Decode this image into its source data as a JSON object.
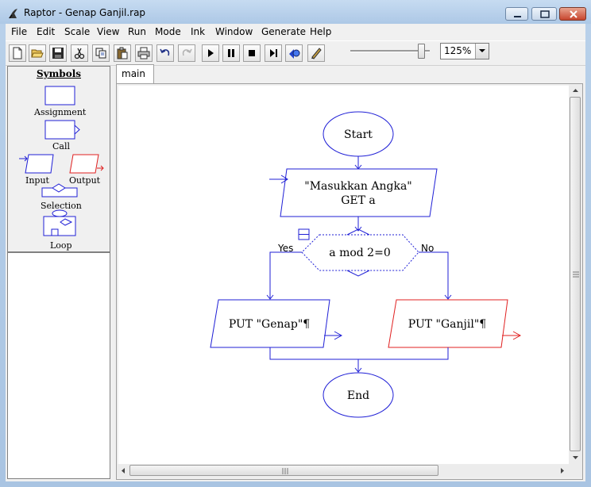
{
  "window": {
    "title": "Raptor - Genap Ganjil.rap"
  },
  "menu": [
    "File",
    "Edit",
    "Scale",
    "View",
    "Run",
    "Mode",
    "Ink",
    "Window",
    "Generate",
    "Help"
  ],
  "toolbar": {
    "buttons": [
      "new-file",
      "open-folder",
      "save",
      "cut",
      "copy",
      "paste",
      "print",
      "undo",
      "redo",
      "run",
      "pause",
      "stop",
      "step",
      "compile",
      "pen"
    ],
    "zoom": "125%",
    "speed_level_percent": 90
  },
  "symbols": {
    "title": "Symbols",
    "assignment": "Assignment",
    "call": "Call",
    "input": "Input",
    "output": "Output",
    "selection": "Selection",
    "loop": "Loop"
  },
  "tabs": [
    {
      "label": "main"
    }
  ],
  "flowchart": {
    "start": "Start",
    "input_prompt": "\"Masukkan Angka\"",
    "input_var": "GET a",
    "condition": "a mod 2=0",
    "yes_label": "Yes",
    "no_label": "No",
    "put_even": "PUT \"Genap\"¶",
    "put_odd": "PUT \"Ganjil\"¶",
    "end": "End"
  },
  "colors": {
    "flow_blue": "#1f1fd6",
    "output_red": "#e02020",
    "title_bar": "#b9d1ea",
    "close_red": "#c7452e"
  }
}
